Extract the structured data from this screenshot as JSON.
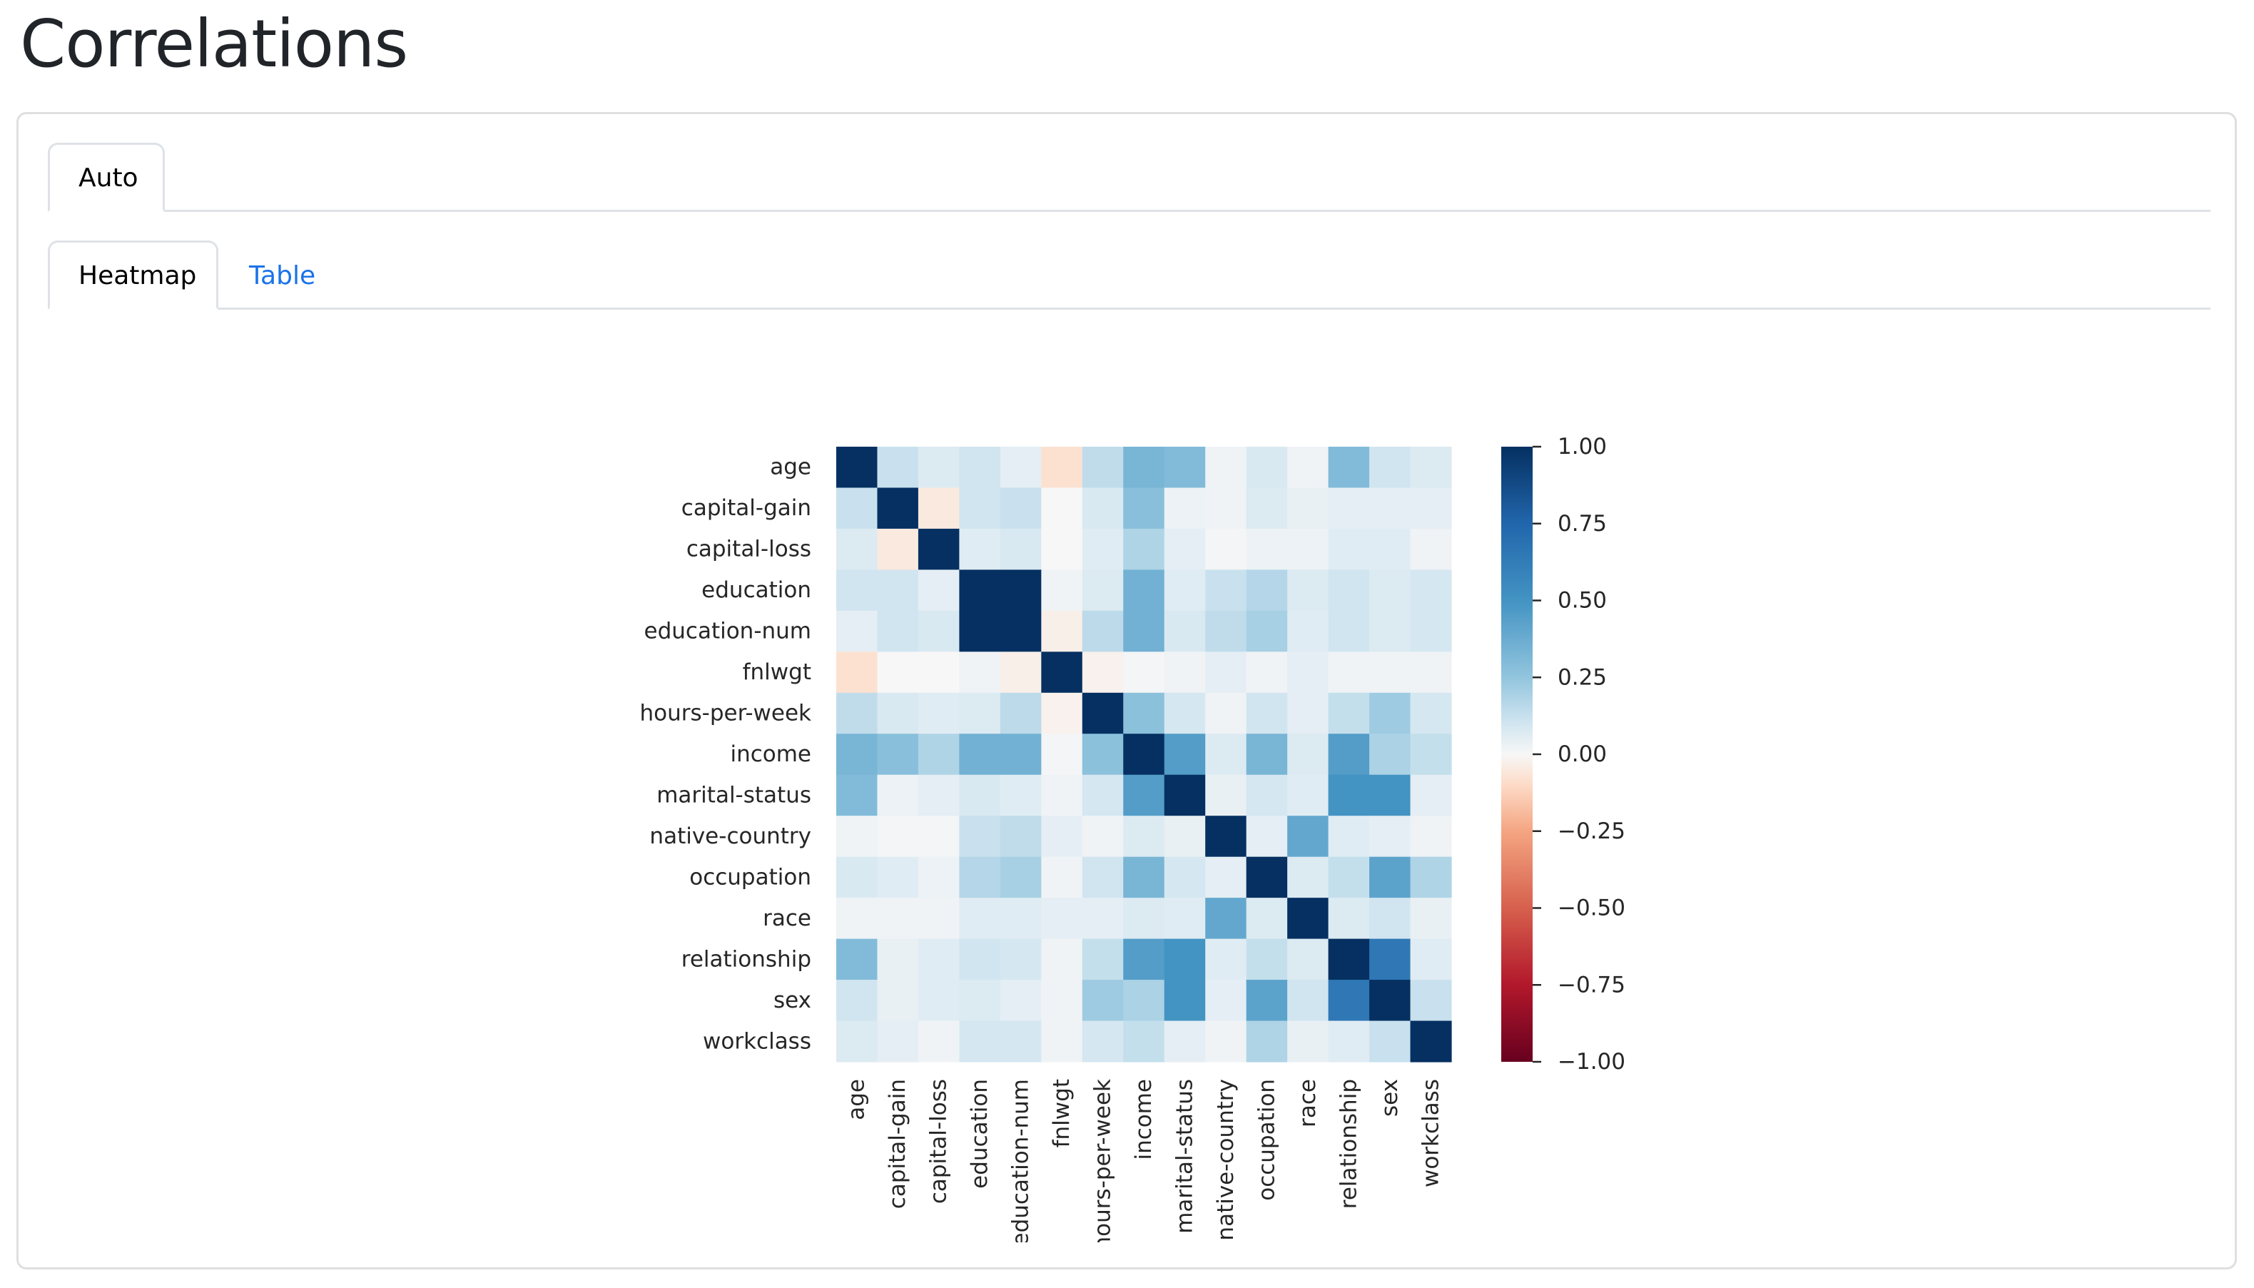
{
  "page": {
    "title": "Correlations"
  },
  "tabs": {
    "outer": [
      {
        "label": "Auto",
        "active": true
      }
    ],
    "inner": [
      {
        "label": "Heatmap",
        "active": true
      },
      {
        "label": "Table",
        "active": false
      }
    ]
  },
  "colors": {
    "link": "#1a73e8",
    "text": "#212529",
    "border": "#dee2e6"
  },
  "chart_data": {
    "type": "heatmap",
    "title": "",
    "xlabel": "",
    "ylabel": "",
    "colormap": "RdBu_r",
    "vmin": -1.0,
    "vmax": 1.0,
    "rows": [
      "age",
      "capital-gain",
      "capital-loss",
      "education",
      "education-num",
      "fnlwgt",
      "hours-per-week",
      "income",
      "marital-status",
      "native-country",
      "occupation",
      "race",
      "relationship",
      "sex",
      "workclass"
    ],
    "columns": [
      "age",
      "capital-gain",
      "capital-loss",
      "education",
      "education-num",
      "fnlwgt",
      "hours-per-week",
      "income",
      "marital-status",
      "native-country",
      "occupation",
      "race",
      "relationship",
      "sex",
      "workclass"
    ],
    "x_tick_labels_visible": [
      "age",
      "capital-gain",
      "capital-loss",
      "education",
      "ducation-num",
      "fnlwgt",
      "ours-per-week",
      "income",
      "marital-status",
      "ative-country",
      "occupation",
      "race",
      "relationship",
      "sex",
      "workclass"
    ],
    "values": [
      [
        1.0,
        0.12,
        0.07,
        0.1,
        0.05,
        -0.08,
        0.14,
        0.33,
        0.3,
        0.02,
        0.08,
        0.02,
        0.3,
        0.1,
        0.07
      ],
      [
        0.12,
        1.0,
        -0.05,
        0.1,
        0.12,
        0.0,
        0.08,
        0.28,
        0.03,
        0.02,
        0.07,
        0.04,
        0.05,
        0.05,
        0.05
      ],
      [
        0.07,
        -0.05,
        1.0,
        0.06,
        0.08,
        0.0,
        0.06,
        0.18,
        0.05,
        0.01,
        0.03,
        0.03,
        0.06,
        0.06,
        0.02
      ],
      [
        0.1,
        0.1,
        0.05,
        1.0,
        1.0,
        0.02,
        0.07,
        0.35,
        0.06,
        0.12,
        0.17,
        0.07,
        0.1,
        0.07,
        0.09
      ],
      [
        0.05,
        0.1,
        0.08,
        1.0,
        1.0,
        -0.03,
        0.15,
        0.35,
        0.08,
        0.14,
        0.2,
        0.06,
        0.1,
        0.07,
        0.09
      ],
      [
        -0.08,
        0.0,
        0.0,
        0.02,
        -0.03,
        1.0,
        -0.02,
        0.01,
        0.02,
        0.05,
        0.02,
        0.05,
        0.02,
        0.02,
        0.02
      ],
      [
        0.14,
        0.08,
        0.06,
        0.07,
        0.15,
        -0.02,
        1.0,
        0.27,
        0.09,
        0.02,
        0.1,
        0.05,
        0.13,
        0.22,
        0.09
      ],
      [
        0.33,
        0.28,
        0.18,
        0.35,
        0.35,
        0.01,
        0.27,
        1.0,
        0.45,
        0.07,
        0.33,
        0.07,
        0.45,
        0.19,
        0.13
      ],
      [
        0.3,
        0.03,
        0.05,
        0.08,
        0.06,
        0.02,
        0.09,
        0.45,
        1.0,
        0.04,
        0.09,
        0.06,
        0.5,
        0.5,
        0.05
      ],
      [
        0.02,
        0.01,
        0.01,
        0.12,
        0.14,
        0.05,
        0.02,
        0.07,
        0.04,
        1.0,
        0.05,
        0.4,
        0.06,
        0.05,
        0.02
      ],
      [
        0.08,
        0.06,
        0.03,
        0.17,
        0.2,
        0.02,
        0.1,
        0.33,
        0.09,
        0.05,
        1.0,
        0.07,
        0.13,
        0.42,
        0.18
      ],
      [
        0.02,
        0.02,
        0.02,
        0.06,
        0.06,
        0.05,
        0.05,
        0.07,
        0.06,
        0.4,
        0.07,
        1.0,
        0.07,
        0.1,
        0.04
      ],
      [
        0.3,
        0.04,
        0.06,
        0.1,
        0.09,
        0.02,
        0.13,
        0.45,
        0.5,
        0.06,
        0.13,
        0.07,
        1.0,
        0.65,
        0.06
      ],
      [
        0.1,
        0.04,
        0.06,
        0.07,
        0.05,
        0.02,
        0.22,
        0.19,
        0.5,
        0.05,
        0.42,
        0.1,
        0.65,
        1.0,
        0.12
      ],
      [
        0.07,
        0.05,
        0.02,
        0.09,
        0.09,
        0.02,
        0.09,
        0.13,
        0.05,
        0.02,
        0.18,
        0.04,
        0.06,
        0.12,
        1.0
      ]
    ],
    "colorbar": {
      "ticks": [
        1.0,
        0.75,
        0.5,
        0.25,
        0.0,
        -0.25,
        -0.5,
        -0.75,
        -1.0
      ],
      "tick_labels": [
        "1.00",
        "0.75",
        "0.50",
        "0.25",
        "0.00",
        "−0.25",
        "−0.50",
        "−0.75",
        "−1.00"
      ],
      "placement": "right"
    },
    "grid": false
  }
}
